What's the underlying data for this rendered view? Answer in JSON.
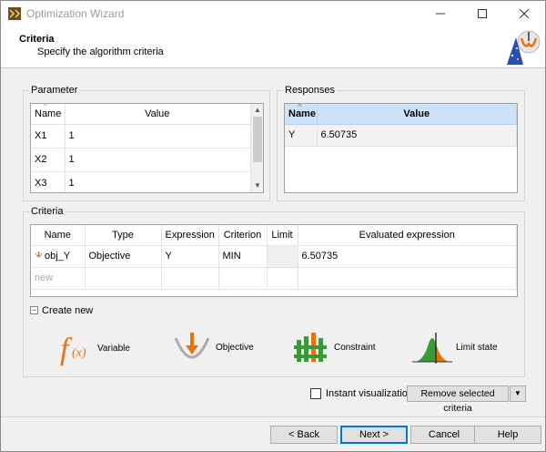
{
  "window": {
    "title": "Optimization Wizard"
  },
  "header": {
    "title": "Criteria",
    "subtitle": "Specify the algorithm criteria"
  },
  "parameter": {
    "group_title": "Parameter",
    "columns": [
      "Name",
      "Value"
    ],
    "rows": [
      [
        "X1",
        "1"
      ],
      [
        "X2",
        "1"
      ],
      [
        "X3",
        "1"
      ]
    ]
  },
  "responses": {
    "group_title": "Responses",
    "columns": [
      "Name",
      "Value"
    ],
    "rows": [
      [
        "Y",
        "6.50735"
      ]
    ]
  },
  "criteria": {
    "group_title": "Criteria",
    "columns": [
      "Name",
      "Type",
      "Expression",
      "Criterion",
      "Limit",
      "Evaluated expression"
    ],
    "rows": [
      [
        "obj_Y",
        "Objective",
        "Y",
        "MIN",
        "",
        "6.50735"
      ]
    ],
    "new_row_label": "new"
  },
  "create_new": {
    "label": "Create new",
    "tools": [
      {
        "label": "Variable",
        "icon": "function-icon"
      },
      {
        "label": "Objective",
        "icon": "objective-icon"
      },
      {
        "label": "Constraint",
        "icon": "constraint-icon"
      },
      {
        "label": "Limit state",
        "icon": "limit-state-icon"
      }
    ]
  },
  "instant_visualization": {
    "label": "Instant visualization",
    "checked": false
  },
  "remove_button": "Remove selected criteria",
  "buttons": {
    "back": "< Back",
    "next": "Next >",
    "cancel": "Cancel",
    "help": "Help"
  },
  "colors": {
    "selection_header": "#cde2f7",
    "accent": "#0078d7",
    "objective_orange": "#e8720c"
  }
}
